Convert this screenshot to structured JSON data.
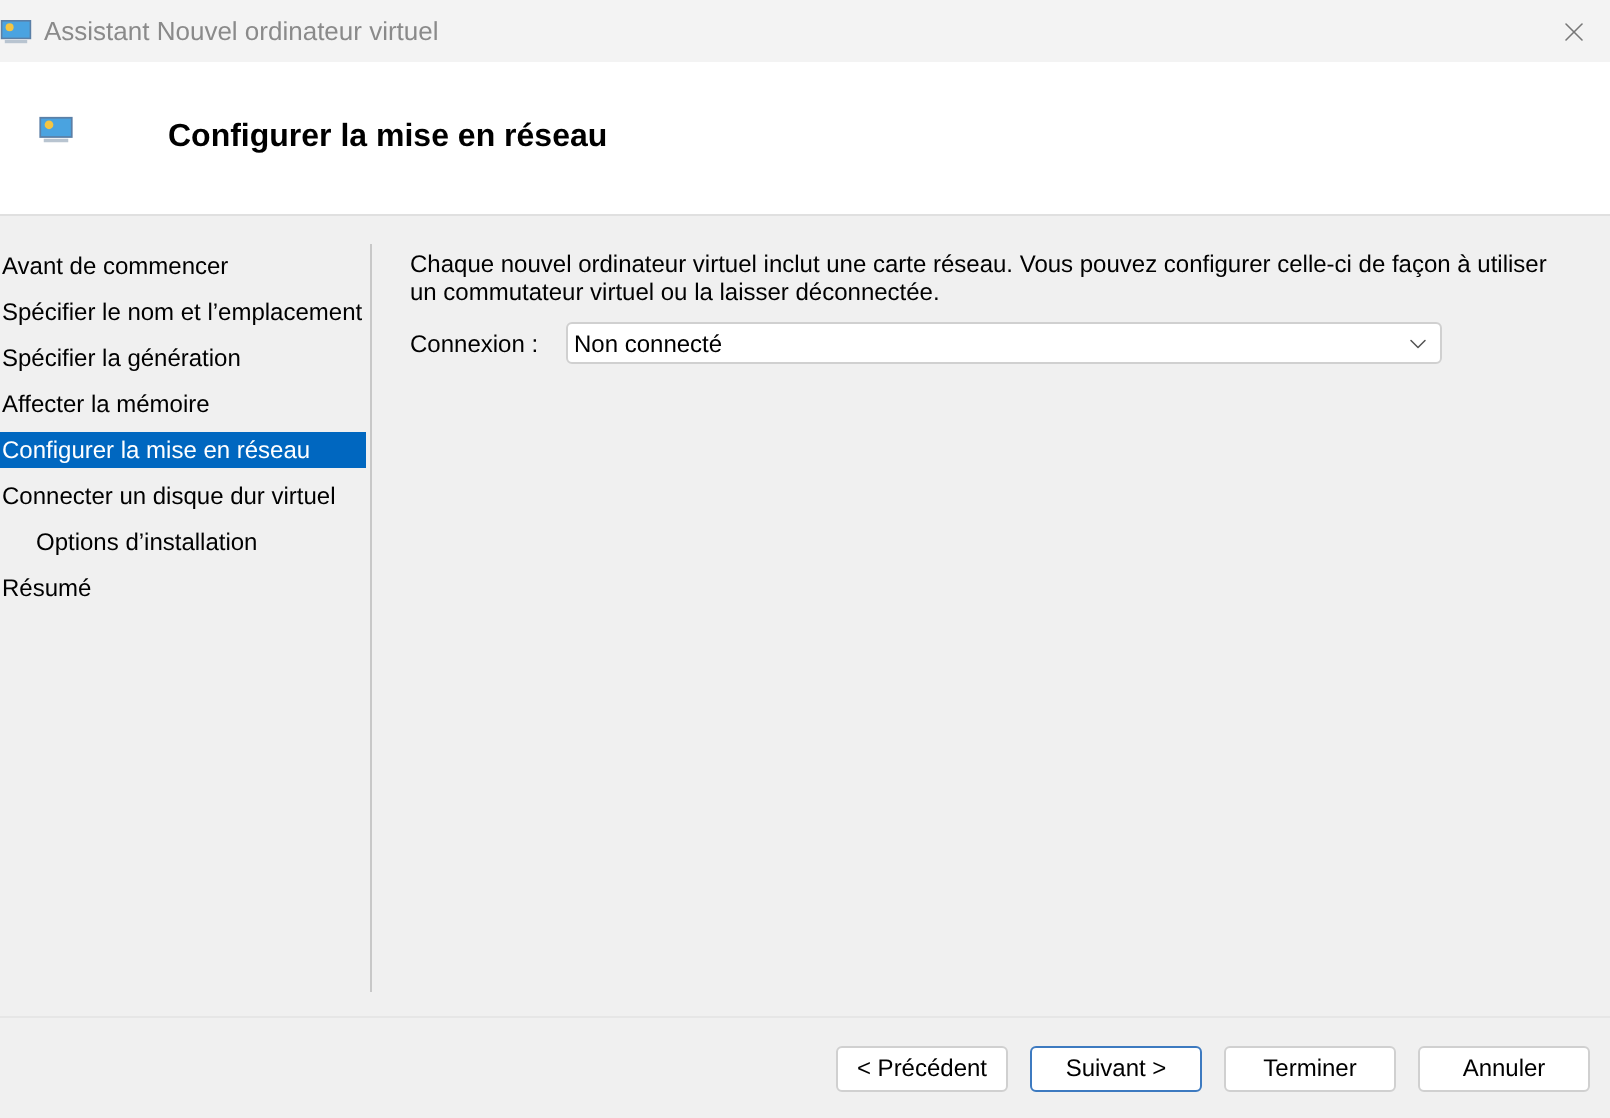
{
  "window": {
    "title": "Assistant Nouvel ordinateur virtuel"
  },
  "header": {
    "title": "Configurer la mise en réseau"
  },
  "sidebar": {
    "items": [
      {
        "label": "Avant de commencer",
        "selected": false
      },
      {
        "label": "Spécifier le nom et l’emplacement",
        "selected": false
      },
      {
        "label": "Spécifier la génération",
        "selected": false
      },
      {
        "label": "Affecter la mémoire",
        "selected": false
      },
      {
        "label": "Configurer la mise en réseau",
        "selected": true
      },
      {
        "label": "Connecter un disque dur virtuel",
        "selected": false,
        "children": [
          {
            "label": "Options d’installation",
            "selected": false
          }
        ]
      },
      {
        "label": "Résumé",
        "selected": false
      }
    ]
  },
  "content": {
    "description": "Chaque nouvel ordinateur virtuel inclut une carte réseau. Vous pouvez configurer celle-ci de façon à utiliser un commutateur virtuel ou la laisser déconnectée.",
    "connection": {
      "label": "Connexion :",
      "value": "Non connecté"
    }
  },
  "buttons": [
    {
      "label": "< Précédent",
      "default": false
    },
    {
      "label": "Suivant >",
      "default": true
    },
    {
      "label": "Terminer",
      "default": false
    },
    {
      "label": "Annuler",
      "default": false
    }
  ]
}
